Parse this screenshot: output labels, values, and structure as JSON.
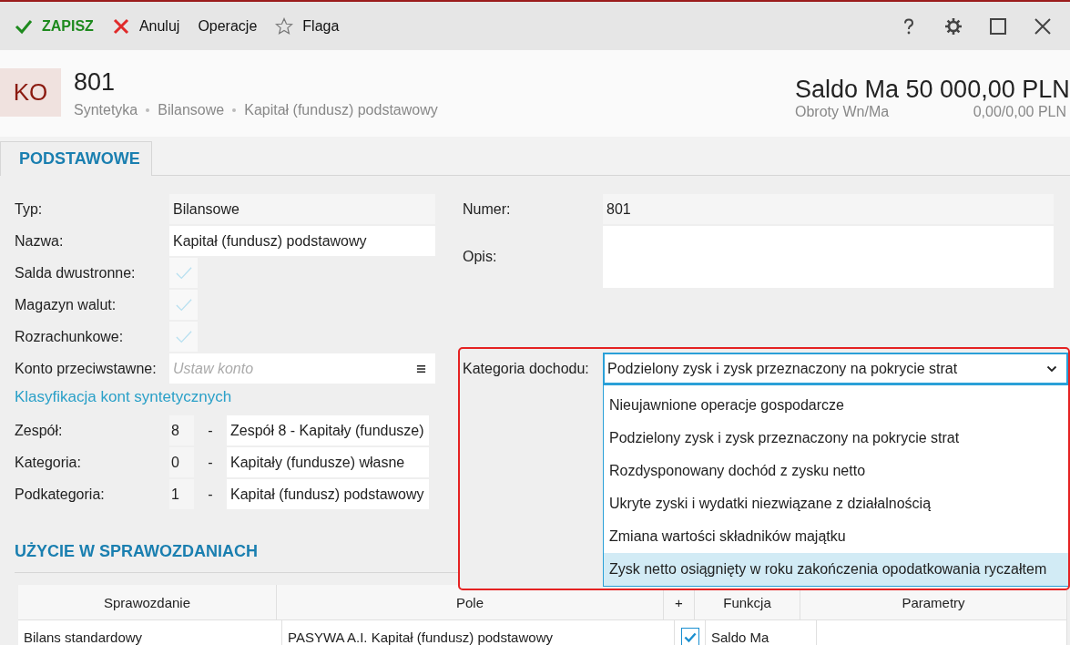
{
  "toolbar": {
    "buttons": [
      {
        "kind": "save",
        "label": "ZAPISZ"
      },
      {
        "kind": "cancel",
        "label": "Anuluj"
      },
      {
        "kind": "plain",
        "label": "Operacje"
      },
      {
        "kind": "flag",
        "label": "Flaga"
      }
    ]
  },
  "header": {
    "badge": "KO",
    "number": "801",
    "breadcrumb": [
      "Syntetyka",
      "Bilansowe",
      "Kapitał (fundusz) podstawowy"
    ],
    "balance": "Saldo Ma 50 000,00 PLN",
    "turnover_label": "Obroty Wn/Ma",
    "turnover_value": "0,00/0,00 PLN"
  },
  "tabs": [
    {
      "label": "PODSTAWOWE",
      "selected": true
    }
  ],
  "form_left": [
    {
      "kind": "readonly",
      "label": "Typ:",
      "value": "Bilansowe"
    },
    {
      "kind": "text",
      "label": "Nazwa:",
      "value": "Kapitał (fundusz) podstawowy"
    },
    {
      "kind": "checkbox",
      "label": "Salda dwustronne:",
      "checked": false
    },
    {
      "kind": "checkbox",
      "label": "Magazyn walut:",
      "checked": false
    },
    {
      "kind": "checkbox",
      "label": "Rozrachunkowe:",
      "checked": false
    },
    {
      "kind": "picker",
      "label": "Konto przeciwstawne:",
      "placeholder": "Ustaw konto"
    }
  ],
  "classification_link": "Klasyfikacja kont syntetycznych",
  "classification": [
    {
      "label": "Zespół:",
      "code": "8",
      "separator": "-",
      "name": "Zespół 8 - Kapitały (fundusze)"
    },
    {
      "label": "Kategoria:",
      "code": "0",
      "separator": "-",
      "name": "Kapitały (fundusze) własne"
    },
    {
      "label": "Podkategoria:",
      "code": "1",
      "separator": "-",
      "name": "Kapitał (fundusz) podstawowy"
    }
  ],
  "form_right": [
    {
      "kind": "readonly",
      "label": "Numer:",
      "value": "801"
    },
    {
      "kind": "textarea",
      "label": "Opis:"
    }
  ],
  "income_category": {
    "label": "Kategoria dochodu:",
    "value": "Podzielony zysk i zysk przeznaczony na pokrycie strat",
    "options": [
      {
        "label": "Nieujawnione operacje gospodarcze",
        "highlighted": false
      },
      {
        "label": "Podzielony zysk i zysk przeznaczony na pokrycie strat",
        "highlighted": false
      },
      {
        "label": "Rozdysponowany dochód z zysku netto",
        "highlighted": false
      },
      {
        "label": "Ukryte zyski i wydatki niezwiązane z działalnością",
        "highlighted": false
      },
      {
        "label": "Zmiana wartości składników majątku",
        "highlighted": false
      },
      {
        "label": "Zysk netto osiągnięty w roku zakończenia opodatkowania ryczałtem",
        "highlighted": true
      }
    ]
  },
  "section_title": "UŻYCIE W SPRAWOZDANIACH",
  "table": {
    "columns": [
      "Sprawozdanie",
      "Pole",
      "+",
      "Funkcja",
      "Parametry"
    ],
    "rows": [
      {
        "report": "Bilans standardowy",
        "field": "PASYWA A.I. Kapitał (fundusz) podstawowy",
        "checked": true,
        "function": "Saldo Ma"
      }
    ]
  }
}
